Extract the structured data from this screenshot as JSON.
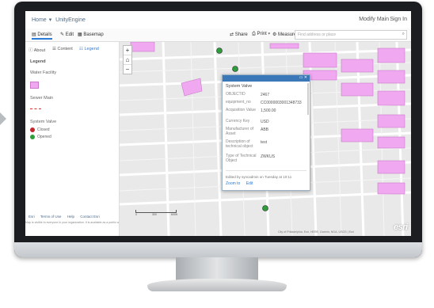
{
  "header": {
    "home": "Home",
    "title": "UnityEngine",
    "user": "Modify Main",
    "sign_in": "Sign In"
  },
  "toolbar": {
    "details": "Details",
    "edit": "Edit",
    "basemap": "Basemap",
    "share": "Share",
    "print": "Print",
    "measure": "Measure",
    "search_placeholder": "Find address or place"
  },
  "left_panel": {
    "tabs": [
      "About",
      "Content",
      "Legend"
    ],
    "legend_title": "Legend",
    "layers": [
      {
        "title": "Water Facility",
        "items": []
      },
      {
        "title": "Sewer Main",
        "items": []
      },
      {
        "title": "System Valve",
        "items": [
          "Closed",
          "Opened"
        ]
      }
    ],
    "footer_links": [
      "Esri",
      "Terms of Use",
      "Help",
      "Contact Esri"
    ],
    "notice": "Map is visible to everyone in your organization. It is available as a public web application."
  },
  "map": {
    "zoom_in": "+",
    "home": "⌂",
    "zoom_out": "−",
    "scale_labels": [
      "0",
      "300",
      "600ft"
    ],
    "attribution": "City of Philadelphia, Esri, HERE, Garmin, NGA, USGS | Esri",
    "logo": "esri"
  },
  "popup": {
    "header_controls": "▭ ✕",
    "title": "System Valve",
    "rows": [
      {
        "label": "OBJECTID",
        "value": "2467"
      },
      {
        "label": "equipment_no",
        "value": "CC0000003001348733"
      },
      {
        "label": "Acquisition Value",
        "value": "1,500.00"
      },
      {
        "label": "Currency Key",
        "value": "USD"
      },
      {
        "label": "Manufacturer of Asset",
        "value": "ABB"
      },
      {
        "label": "Description of technical object",
        "value": "test"
      },
      {
        "label": "Type of Technical Object",
        "value": "ZWKUS"
      }
    ],
    "edited_note": "Edited by syncadmin on Tuesday at 10:11",
    "zoom_to": "Zoom to",
    "edit": "Edit"
  },
  "colors": {
    "accent": "#2a7bd6",
    "facility_fill": "#f0a8f0",
    "valve_closed": "#c0282d",
    "valve_opened": "#2e9e3c",
    "sewer": "#d43030"
  }
}
